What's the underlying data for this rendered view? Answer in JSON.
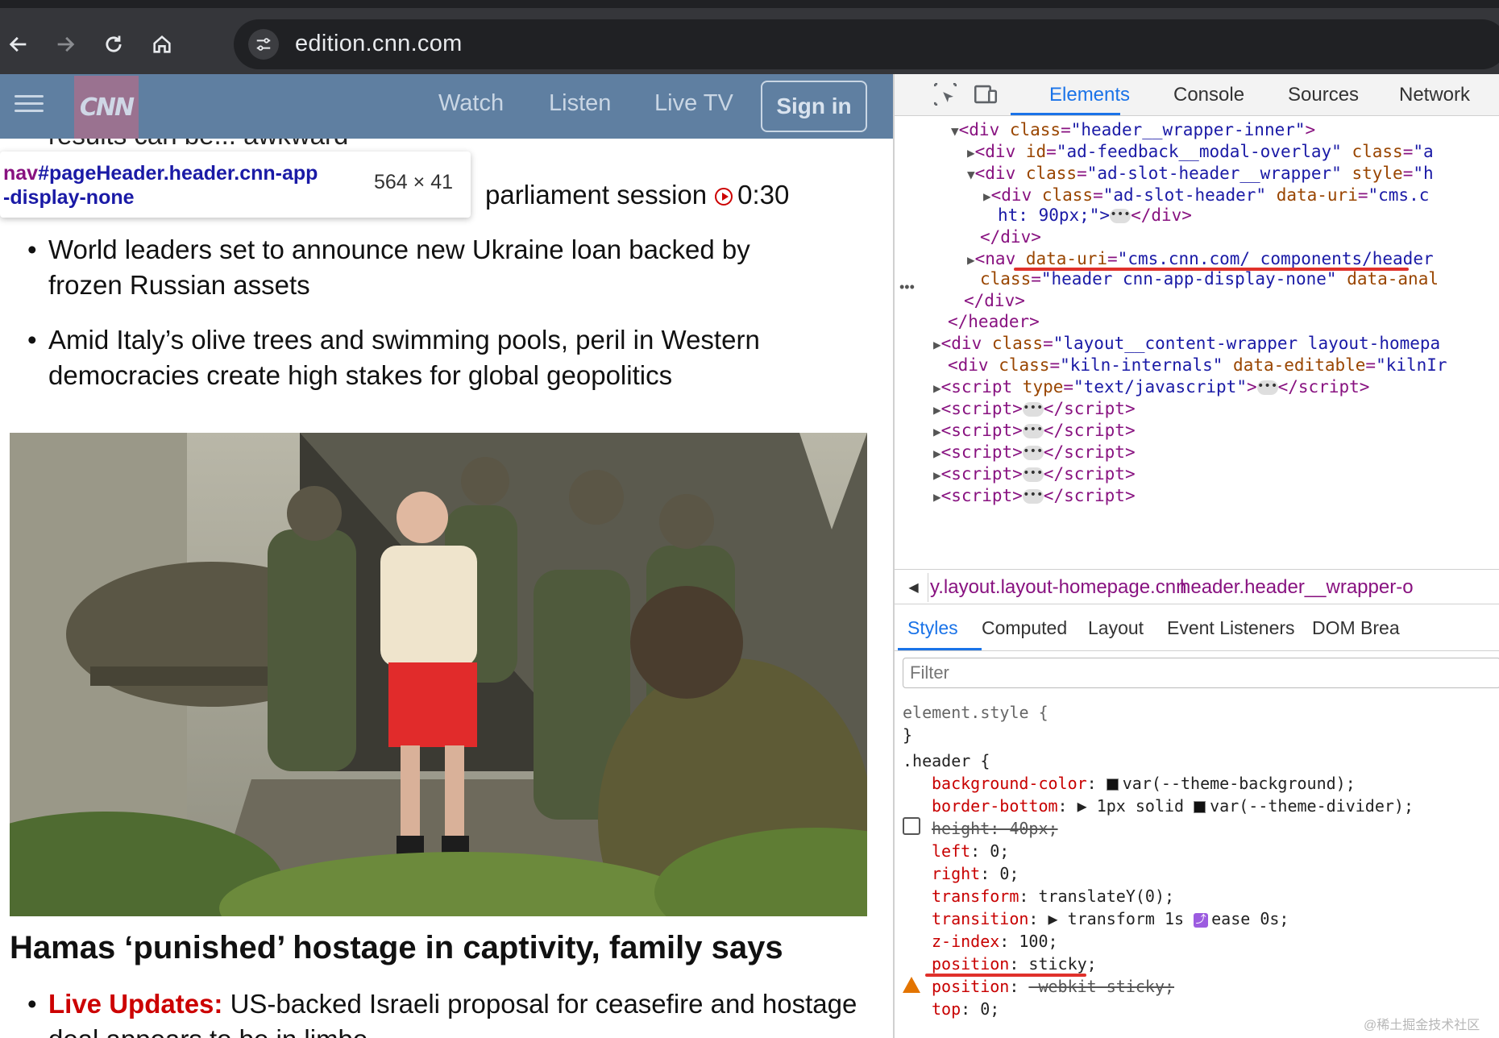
{
  "browser": {
    "url": "edition.cnn.com",
    "back_icon": "arrow-left-icon",
    "forward_icon": "arrow-right-icon",
    "reload_icon": "reload-icon",
    "home_icon": "home-icon"
  },
  "page": {
    "header": {
      "logo": "CNN",
      "links": [
        "Watch",
        "Listen",
        "Live TV"
      ],
      "signin": "Sign in"
    },
    "cut_text": "results can be... awkward",
    "tooltip": {
      "selector_tag": "nav",
      "selector_rest_1": "#pageHeader.header.cnn-app",
      "selector_rest_2": "-display-none",
      "size": "564 × 41"
    },
    "parliament_line": "parliament session",
    "video_duration": "0:30",
    "bullets": [
      "World leaders set to announce new Ukraine loan backed by frozen Russian assets",
      "Amid Italy’s olive trees and swimming pools, peril in Western democracies create high stakes for global geopolitics"
    ],
    "main_headline": "Hamas ‘punished’ hostage in captivity, family says",
    "live_label": "Live Updates:",
    "live_text": "US-backed Israeli proposal for ceasefire and hostage deal appears to be in limbo"
  },
  "devtools": {
    "tabs": [
      "Elements",
      "Console",
      "Sources",
      "Network"
    ],
    "active_tab": "Elements",
    "dom": {
      "l1_tag_open": "<div ",
      "l1_attr": "class",
      "l1_val": "\"header__wrapper-inner\"",
      "l2_attr1": "id",
      "l2_val1": "\"ad-feedback__modal-overlay\"",
      "l2_attr2": "class",
      "l2_val2": "\"a",
      "l3_attr1": "class",
      "l3_val1": "\"ad-slot-header__wrapper\"",
      "l3_attr2": "style",
      "l3_val2": "\"h",
      "l4_attr1": "class",
      "l4_val1": "\"ad-slot-header\"",
      "l4_attr2": "data-uri",
      "l4_val2": "\"cms.c",
      "l5_text": "ht: 90px;\">",
      "l5_close": "</div>",
      "l6_close": "</div>",
      "l7_attr": "data-uri",
      "l7_val": "\"cms.cnn.com/_components/header",
      "l8_attr1": "class",
      "l8_val1": "\"header cnn-app-display-none\"",
      "l8_attr2": "data-anal",
      "l9_close": "</div>",
      "l10_close": "</header>",
      "l11_attr": "class",
      "l11_val": "\"layout__content-wrapper layout-homepa",
      "l12_attr1": "class",
      "l12_val1": "\"kiln-internals\"",
      "l12_attr2": "data-editable",
      "l12_val2": "\"kilnIr",
      "l13_attr": "type",
      "l13_val": "\"text/javascript\"",
      "script_lines": 5
    },
    "breadcrumbs": [
      "y.layout.layout-homepage.cnn",
      "header.header__wrapper-o"
    ],
    "styles_tabs": [
      "Styles",
      "Computed",
      "Layout",
      "Event Listeners",
      "DOM Brea"
    ],
    "filter_placeholder": "Filter",
    "css": {
      "element_style": "element.style {",
      "close_brace": "}",
      "selector": ".header {",
      "bg_prop": "background-color",
      "bg_val": "var(--theme-background);",
      "bb_prop": "border-bottom",
      "bb_val": "1px solid",
      "bb_val2": "var(--theme-divider);",
      "height_line": "height: 40px;",
      "left_prop": "left",
      "left_val": "0;",
      "right_prop": "right",
      "right_val": "0;",
      "transform_prop": "transform",
      "transform_val": "translateY(0);",
      "transition_prop": "transition",
      "transition_val1": "transform 1s",
      "transition_val2": "ease 0s;",
      "z_prop": "z-index",
      "z_val": "100;",
      "pos_prop": "position",
      "pos_val": "sticky;",
      "pos2_prop": "position",
      "pos2_val": "-webkit-sticky;",
      "top_prop": "top",
      "top_val": "0;"
    },
    "watermark": "@稀土掘金技术社区"
  }
}
